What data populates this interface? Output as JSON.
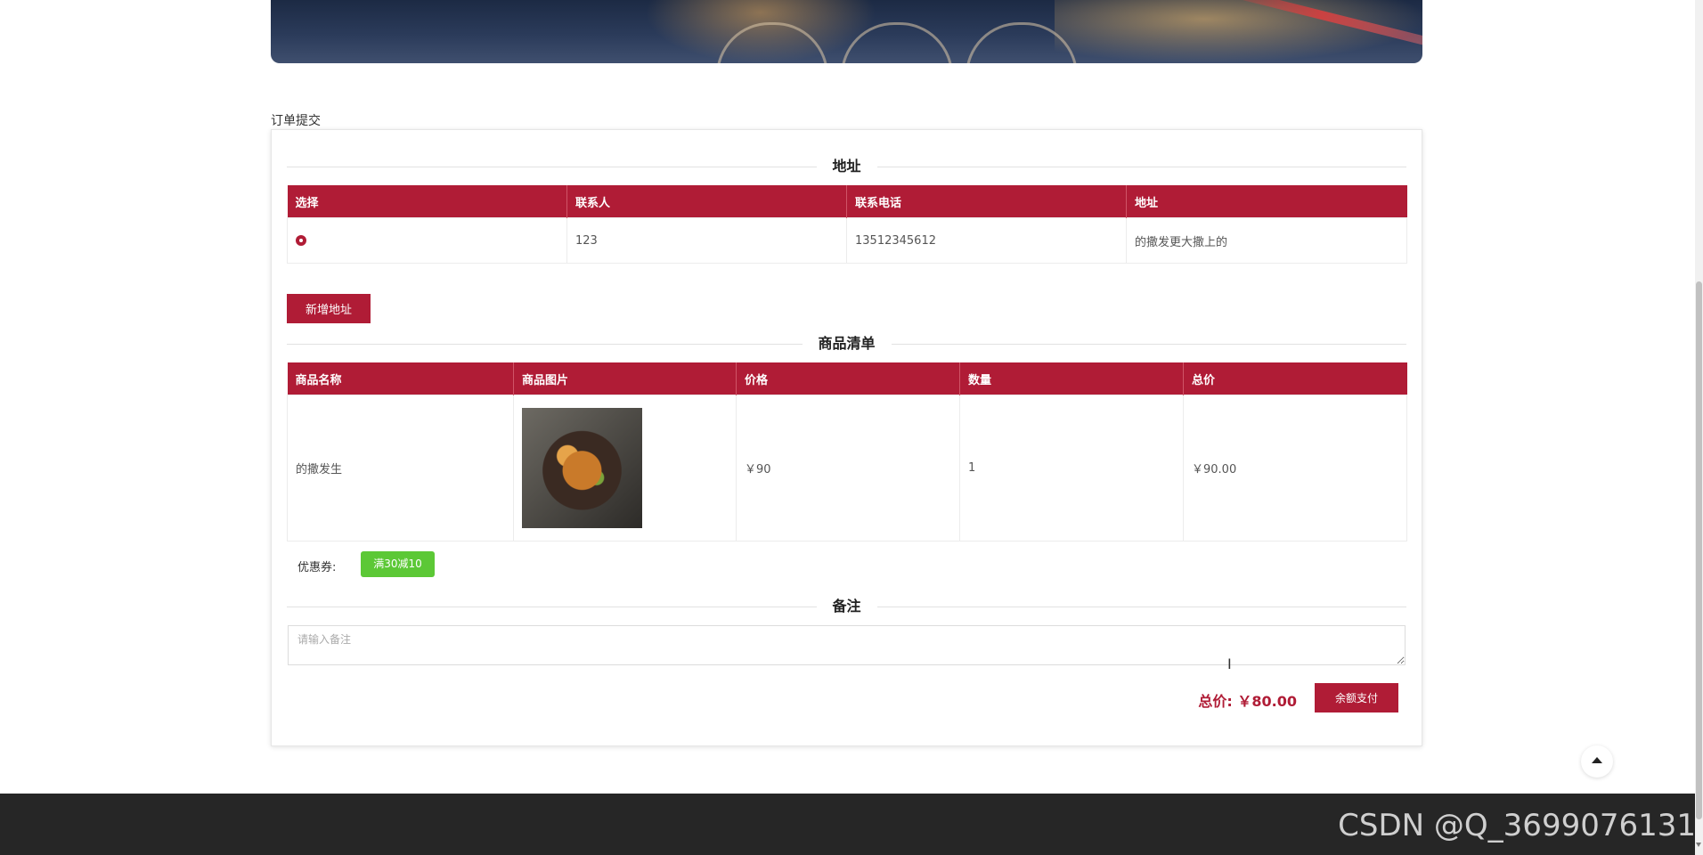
{
  "breadcrumb": "订单提交",
  "address_section": {
    "title": "地址",
    "headers": [
      "选择",
      "联系人",
      "联系电话",
      "地址"
    ],
    "rows": [
      {
        "contact": "123",
        "phone": "13512345612",
        "address": "的撒发更大撒上的"
      }
    ],
    "add_button": "新增地址"
  },
  "goods_section": {
    "title": "商品清单",
    "headers": [
      "商品名称",
      "商品图片",
      "价格",
      "数量",
      "总价"
    ],
    "rows": [
      {
        "name": "的撒发生",
        "image_icon": "food-dish-image",
        "price": "￥90",
        "quantity": "1",
        "total": "￥90.00"
      }
    ]
  },
  "coupon": {
    "label": "优惠券:",
    "tag": "满30减10",
    "tag_color": "#5cc836"
  },
  "remark_section": {
    "title": "备注",
    "placeholder": "请输入备注"
  },
  "summary": {
    "total_label": "总价: ￥80.00",
    "pay_button": "余额支付"
  },
  "back_to_top_icon": "arrow-up-icon",
  "watermark": "CSDN @Q_3699076131",
  "colors": {
    "accent": "#b01c36",
    "footer": "#262626"
  }
}
